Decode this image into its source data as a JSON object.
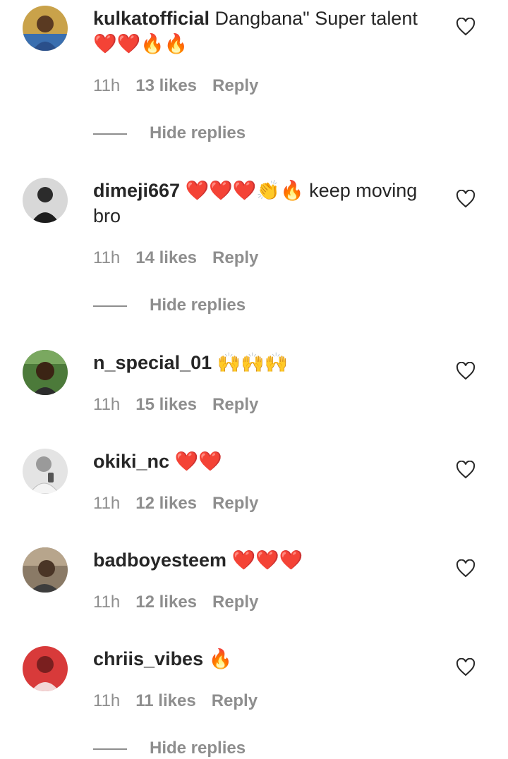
{
  "comments": [
    {
      "username": "kulkatofficial",
      "text": " Dangbana\" Super talent ❤️❤️🔥🔥",
      "time": "11h",
      "likes": "13 likes",
      "reply": "Reply",
      "hide_replies": "Hide replies"
    },
    {
      "username": "dimeji667",
      "text": " ❤️❤️❤️👏🔥 keep moving bro",
      "time": "11h",
      "likes": "14 likes",
      "reply": "Reply",
      "hide_replies": "Hide replies"
    },
    {
      "username": "n_special_01",
      "text": " 🙌🙌🙌",
      "time": "11h",
      "likes": "15 likes",
      "reply": "Reply"
    },
    {
      "username": "okiki_nc",
      "text": " ❤️❤️",
      "time": "11h",
      "likes": "12 likes",
      "reply": "Reply"
    },
    {
      "username": "badboyesteem",
      "text": " ❤️❤️❤️",
      "time": "11h",
      "likes": "12 likes",
      "reply": "Reply"
    },
    {
      "username": "chriis_vibes",
      "text": " 🔥",
      "time": "11h",
      "likes": "11 likes",
      "reply": "Reply",
      "hide_replies": "Hide replies"
    }
  ],
  "colors": {
    "primary_text": "#262626",
    "secondary_text": "#8e8e8e",
    "background": "#ffffff"
  },
  "icons": {
    "like": "heart-outline-icon"
  }
}
